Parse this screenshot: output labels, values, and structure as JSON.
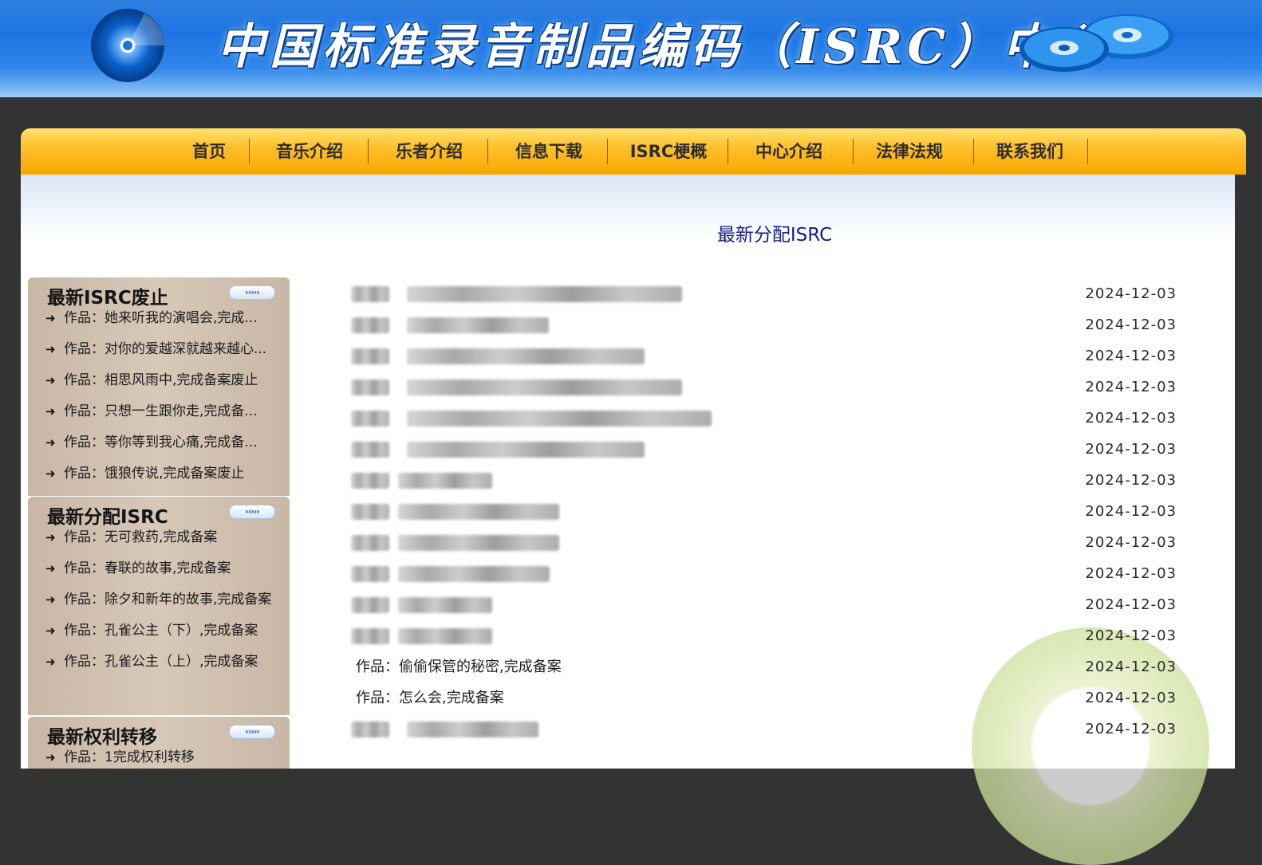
{
  "header": {
    "title": "中国标准录音制品编码（ISRC）中心"
  },
  "nav": {
    "items": [
      "首页",
      "音乐介绍",
      "乐者介绍",
      "信息下载",
      "ISRC梗概",
      "中心介绍",
      "法律法规",
      "联系我们"
    ]
  },
  "main": {
    "section_title": "最新分配ISRC"
  },
  "sidebar": {
    "more_label": "›››››",
    "boxes": [
      {
        "title": "最新ISRC废止",
        "items": [
          "作品：她来听我的演唱会,完成...",
          "作品：对你的爱越深就越来越心...",
          "作品：相思风雨中,完成备案废止",
          "作品：只想一生跟你走,完成备...",
          "作品：等你等到我心痛,完成备...",
          "作品：饿狼传说,完成备案废止"
        ]
      },
      {
        "title": "最新分配ISRC",
        "items": [
          "作品：无可救药,完成备案",
          "作品：春联的故事,完成备案",
          "作品：除夕和新年的故事,完成备案",
          "作品：孔雀公主（下）,完成备案",
          "作品：孔雀公主（上）,完成备案"
        ]
      },
      {
        "title": "最新权利转移",
        "items": [
          "作品：1完成权利转移"
        ]
      }
    ]
  },
  "list": {
    "rows": [
      {
        "text": "",
        "date": "2024-12-03"
      },
      {
        "text": "",
        "date": "2024-12-03"
      },
      {
        "text": "",
        "date": "2024-12-03"
      },
      {
        "text": "",
        "date": "2024-12-03"
      },
      {
        "text": "",
        "date": "2024-12-03"
      },
      {
        "text": "",
        "date": "2024-12-03"
      },
      {
        "text": "",
        "date": "2024-12-03"
      },
      {
        "text": "",
        "date": "2024-12-03"
      },
      {
        "text": "",
        "date": "2024-12-03"
      },
      {
        "text": "",
        "date": "2024-12-03"
      },
      {
        "text": "",
        "date": "2024-12-03"
      },
      {
        "text": "",
        "date": "2024-12-03"
      },
      {
        "text": "作品：偷偷保管的秘密,完成备案",
        "date": "2024-12-03"
      },
      {
        "text": "作品：怎么会,完成备案",
        "date": "2024-12-03"
      },
      {
        "text": "",
        "date": "2024-12-03"
      }
    ]
  },
  "colors": {
    "banner_blue": "#1c74e2",
    "nav_orange": "#ffc12c",
    "section_title": "#14208a",
    "sidebar_tan": "#c9b7a6"
  }
}
